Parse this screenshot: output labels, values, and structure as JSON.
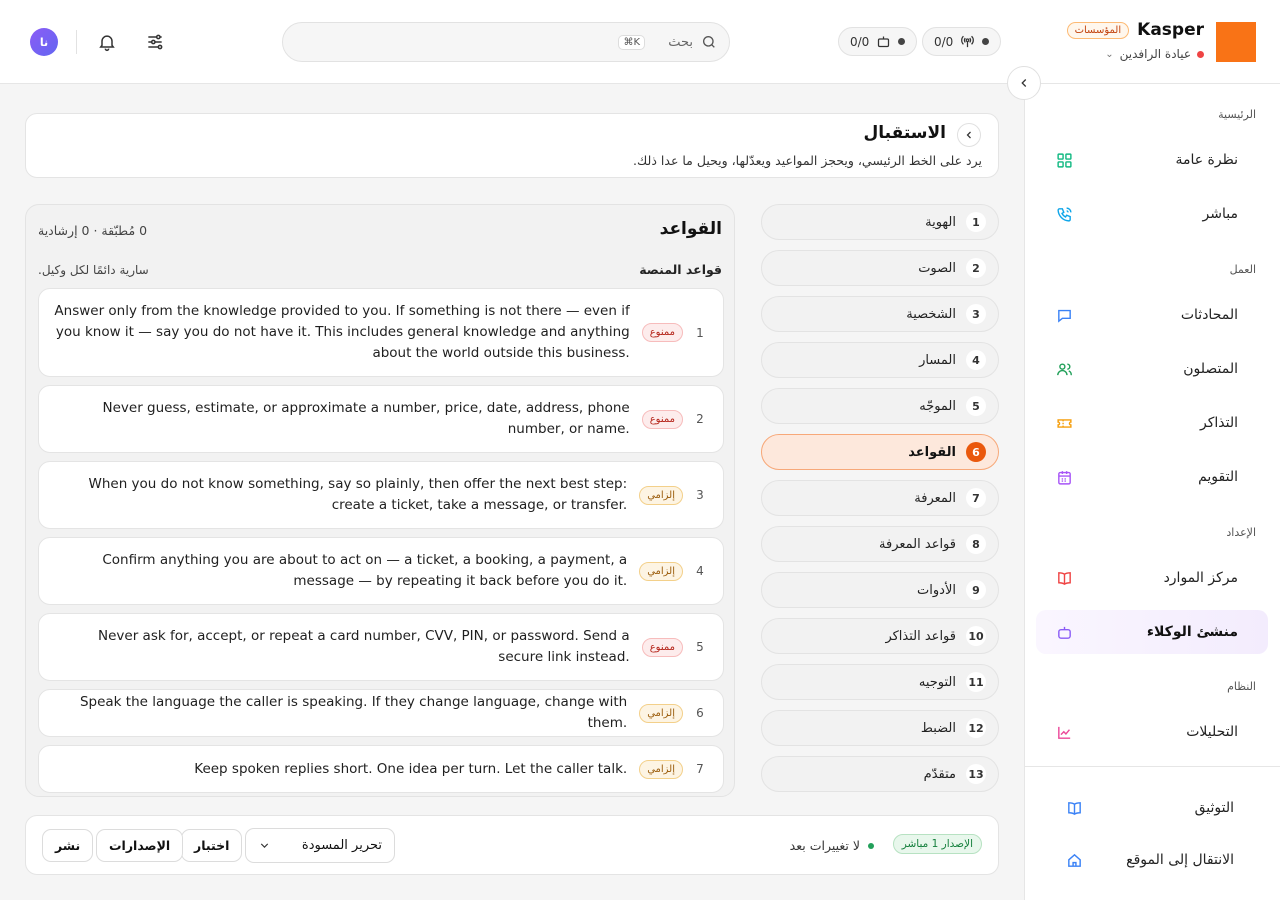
{
  "topbar": {
    "brand_name": "Kasper",
    "org_badge": "المؤسسات",
    "clinic_name": "عيادة الرافدين",
    "stat_calls": "0/0",
    "stat_agents": "0/0",
    "search_placeholder": "بحث",
    "search_shortcut": "⌘K",
    "avatar_initials": "نا"
  },
  "sidebar": {
    "sections": [
      {
        "title": "الرئيسية",
        "items": [
          {
            "label": "نظرة عامة",
            "icon": "overview-icon",
            "color": "#10b981"
          },
          {
            "label": "مباشر",
            "icon": "phone-icon",
            "color": "#0ea5e9"
          }
        ]
      },
      {
        "title": "العمل",
        "items": [
          {
            "label": "المحادثات",
            "icon": "chat-icon",
            "color": "#3b82f6"
          },
          {
            "label": "المتصلون",
            "icon": "users-icon",
            "color": "#22a05a"
          },
          {
            "label": "التذاكر",
            "icon": "ticket-icon",
            "color": "#f59e0b"
          },
          {
            "label": "التقويم",
            "icon": "calendar-icon",
            "color": "#a855f7"
          }
        ]
      },
      {
        "title": "الإعداد",
        "items": [
          {
            "label": "مركز الموارد",
            "icon": "book-icon",
            "color": "#ef4444"
          },
          {
            "label": "منشئ الوكلاء",
            "icon": "bot-icon",
            "color": "#8b5cf6",
            "active": true
          }
        ]
      },
      {
        "title": "النظام",
        "items": [
          {
            "label": "التحليلات",
            "icon": "chart-icon",
            "color": "#ec4899"
          }
        ]
      }
    ],
    "bottom": [
      {
        "label": "التوثيق",
        "icon": "docs-icon",
        "color": "#3b82f6"
      },
      {
        "label": "الانتقال إلى الموقع",
        "icon": "home-icon",
        "color": "#3b82f6"
      }
    ]
  },
  "header": {
    "title": "الاستقبال",
    "subtitle": "يرد على الخط الرئيسي، ويحجز المواعيد ويعدّلها، ويحيل ما عدا ذلك."
  },
  "steps": [
    {
      "num": "1",
      "label": "الهوية"
    },
    {
      "num": "2",
      "label": "الصوت"
    },
    {
      "num": "3",
      "label": "الشخصية"
    },
    {
      "num": "4",
      "label": "المسار"
    },
    {
      "num": "5",
      "label": "الموجّه"
    },
    {
      "num": "6",
      "label": "القواعد",
      "active": true
    },
    {
      "num": "7",
      "label": "المعرفة"
    },
    {
      "num": "8",
      "label": "قواعد المعرفة"
    },
    {
      "num": "9",
      "label": "الأدوات"
    },
    {
      "num": "10",
      "label": "قواعد التذاكر"
    },
    {
      "num": "11",
      "label": "التوجيه"
    },
    {
      "num": "12",
      "label": "الضبط"
    },
    {
      "num": "13",
      "label": "متقدّم"
    }
  ],
  "rules": {
    "title": "القواعد",
    "counts": "0 مُطبّقة · 0 إرشادية",
    "platform_title": "قواعد المنصة",
    "platform_note": "سارية دائمًا لكل وكيل.",
    "items": [
      {
        "num": "1",
        "badge": "ممنوع",
        "type": "forbid",
        "text": "Answer only from the knowledge provided to you. If something is not there — even if you know it — say you do not have it. This includes general knowledge and anything about the world outside this business."
      },
      {
        "num": "2",
        "badge": "ممنوع",
        "type": "forbid",
        "text": "Never guess, estimate, or approximate a number, price, date, address, phone number, or name."
      },
      {
        "num": "3",
        "badge": "إلزامي",
        "type": "must",
        "text": "When you do not know something, say so plainly, then offer the next best step: create a ticket, take a message, or transfer."
      },
      {
        "num": "4",
        "badge": "إلزامي",
        "type": "must",
        "text": "Confirm anything you are about to act on — a ticket, a booking, a payment, a message — by repeating it back before you do it."
      },
      {
        "num": "5",
        "badge": "ممنوع",
        "type": "forbid",
        "text": "Never ask for, accept, or repeat a card number, CVV, PIN, or password. Send a secure link instead."
      },
      {
        "num": "6",
        "badge": "إلزامي",
        "type": "must",
        "text": "Speak the language the caller is speaking. If they change language, change with them."
      },
      {
        "num": "7",
        "badge": "إلزامي",
        "type": "must",
        "text": "Keep spoken replies short. One idea per turn. Let the caller talk."
      }
    ]
  },
  "footer": {
    "version_badge": "الإصدار 1 مباشر",
    "status": "لا تغييرات بعد",
    "mode_select": "تحرير المسودة",
    "test_button": "اختبار",
    "versions_button": "الإصدارات",
    "publish_button": "نشر"
  },
  "colors": {
    "accent": "#ea580c",
    "brand": "#f97316"
  }
}
